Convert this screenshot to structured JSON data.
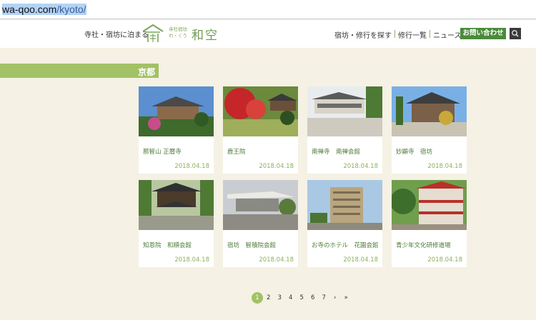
{
  "browser": {
    "url_host": "wa-qoo.com",
    "url_path": "/kyoto/"
  },
  "header": {
    "tagline": "寺社・宿坊に泊まる",
    "logo_small_top": "寺社宿坊",
    "logo_small_bottom": "わ・くう",
    "logo_name": "和空",
    "nav": [
      "宿坊・修行を探す",
      "修行一覧",
      "ニュース"
    ],
    "contact_label": "お問い合わせ",
    "brand_color": "#4a8b3b",
    "accent_color": "#a3c165"
  },
  "section": {
    "title": "京都"
  },
  "cards": [
    {
      "title": "那智山 正暦寺",
      "date": "2018.04.18"
    },
    {
      "title": "鹿王院",
      "date": "2018.04.18"
    },
    {
      "title": "南禅寺　南禅会館",
      "date": "2018.04.18"
    },
    {
      "title": "妙顯寺　宿坊",
      "date": "2018.04.18"
    },
    {
      "title": "知恩院　和順会館",
      "date": "2018.04.18"
    },
    {
      "title": "宿坊　智積院会館",
      "date": "2018.04.18"
    },
    {
      "title": "お寺のホテル　花園会館",
      "date": "2018.04.18"
    },
    {
      "title": "青少年文化研修道場",
      "date": "2018.04.18"
    }
  ],
  "pagination": {
    "current": "1",
    "pages": [
      "2",
      "3",
      "4",
      "5",
      "6",
      "7"
    ],
    "next": "›",
    "last": "»"
  }
}
